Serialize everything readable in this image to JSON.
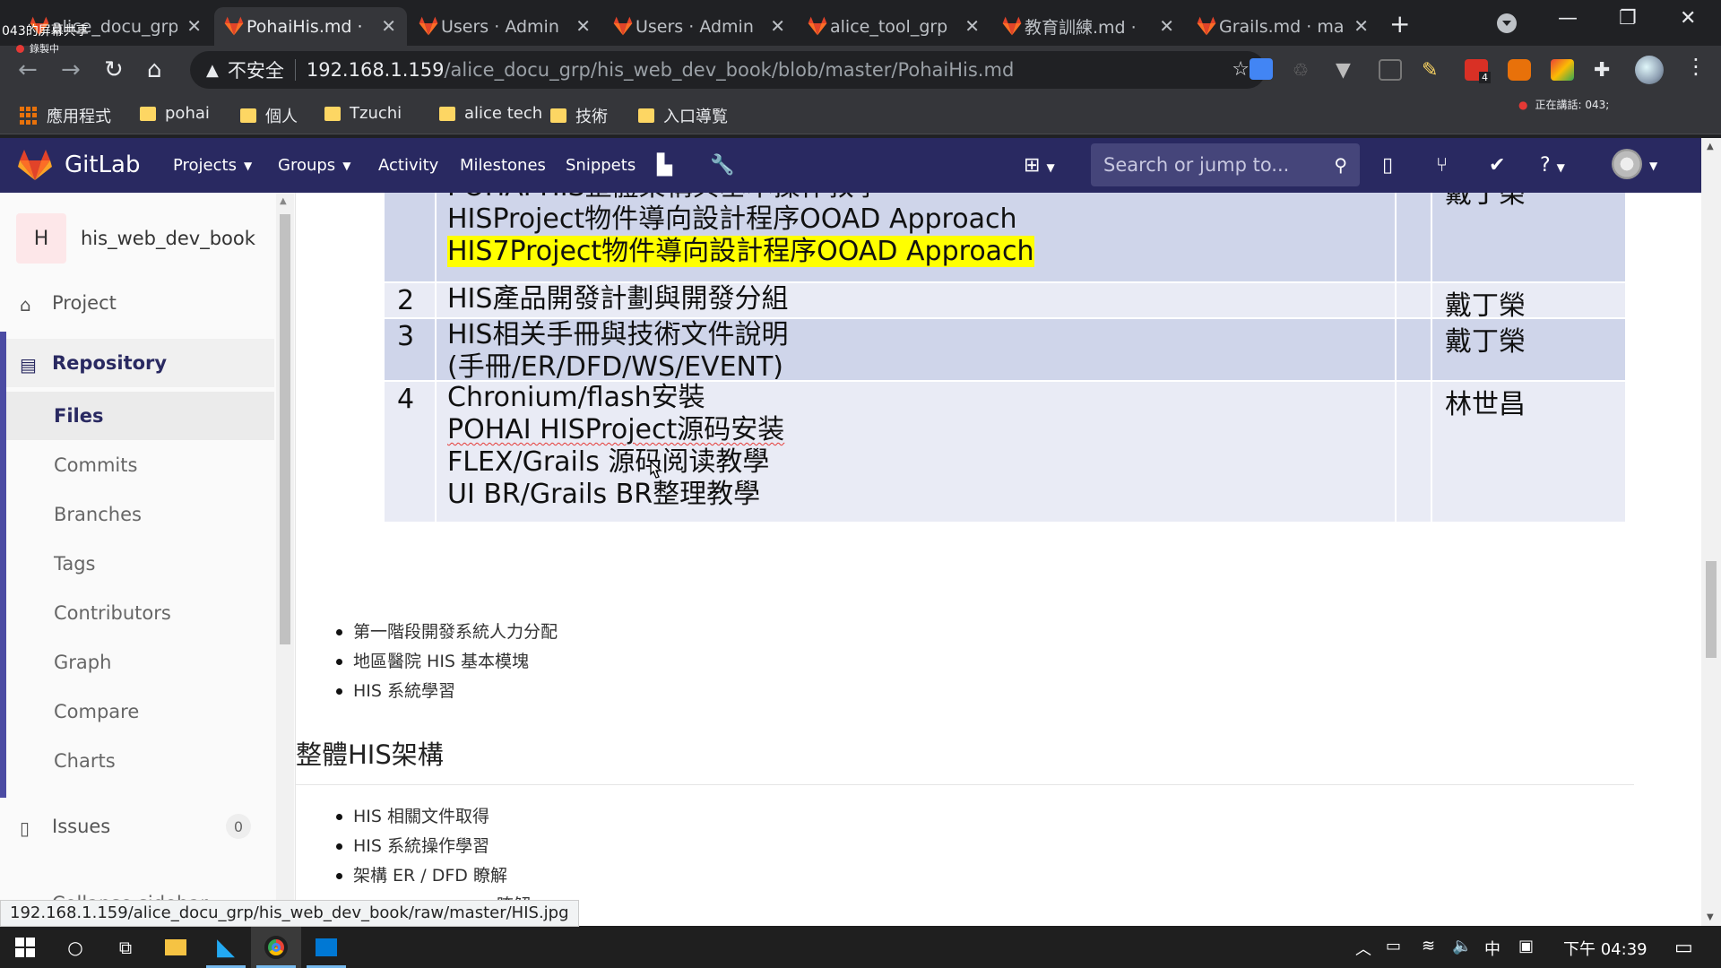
{
  "browser": {
    "recording_label": "錄製中",
    "tabs": [
      {
        "title": "alice_docu_grp",
        "active": false
      },
      {
        "title": "PohaiHis.md ·",
        "active": true
      },
      {
        "title": "Users · Admin",
        "active": false
      },
      {
        "title": "Users · Admin",
        "active": false
      },
      {
        "title": "alice_tool_grp",
        "active": false
      },
      {
        "title": "教育訓練.md ·",
        "active": false
      },
      {
        "title": "Grails.md · ma",
        "active": false
      }
    ],
    "new_tab": "+",
    "tab_close": "✕",
    "address": {
      "security_label": "不安全",
      "host": "192.168.1.159",
      "path": "/alice_docu_grp/his_web_dev_book/blob/master/PohaiHis.md"
    },
    "extension_badge": "4",
    "bookmarks": [
      {
        "label": "應用程式",
        "type": "apps"
      },
      {
        "label": "pohai",
        "type": "folder"
      },
      {
        "label": "個人",
        "type": "folder"
      },
      {
        "label": "Tzuchi",
        "type": "folder"
      },
      {
        "label": "alice tech",
        "type": "folder"
      },
      {
        "label": "技術",
        "type": "folder"
      },
      {
        "label": "入口導覧",
        "type": "folder"
      }
    ],
    "speaking_label": "正在講話: 043;",
    "status_url": "192.168.1.159/alice_docu_grp/his_web_dev_book/raw/master/HIS.jpg"
  },
  "gitlab": {
    "brand": "GitLab",
    "nav": [
      "Projects",
      "Groups",
      "Activity",
      "Milestones",
      "Snippets"
    ],
    "search_placeholder": "Search or jump to...",
    "colors": {
      "header": "#292961",
      "accent": "#fc6d26"
    }
  },
  "sidebar": {
    "project_initial": "H",
    "project_name": "his_web_dev_book",
    "project_label": "Project",
    "repository_label": "Repository",
    "repo_items": [
      "Files",
      "Commits",
      "Branches",
      "Tags",
      "Contributors",
      "Graph",
      "Compare",
      "Charts"
    ],
    "issues_label": "Issues",
    "issues_count": "0",
    "collapse_label": "Collapse sidebar"
  },
  "content": {
    "table_rows": [
      {
        "num": "",
        "lines": [
          "POHAI HIS整體架構與基本操作教學",
          "HISProject物件導向設計程序OOAD Approach",
          "HIS7Project物件導向設計程序OOAD Approach"
        ],
        "person": "戴丁榮"
      },
      {
        "num": "2",
        "lines": [
          "HIS產品開發計劃與開發分組"
        ],
        "person": "戴丁榮"
      },
      {
        "num": "3",
        "lines": [
          "HIS相关手冊與技術文件說明",
          "(手冊/ER/DFD/WS/EVENT)"
        ],
        "person": "戴丁榮"
      },
      {
        "num": "4",
        "lines": [
          "Chronium/flash安裝",
          "POHAI HISProject源码安装",
          "FLEX/Grails 源码阅读教學",
          "UI BR/Grails BR整理教學"
        ],
        "person": "林世昌"
      }
    ],
    "list1": [
      "第一階段開發系統人力分配",
      "地區醫院 HIS 基本模塊",
      "HIS 系統學習"
    ],
    "heading": "整體HIS架構",
    "list2": [
      "HIS 相關文件取得",
      "HIS 系統操作學習",
      "架構 ER / DFD 瞭解",
      "瞭解"
    ]
  },
  "taskbar": {
    "screenshare_label": "043的屏幕共享",
    "ime_label": "中",
    "clock": "下午 04:39"
  }
}
